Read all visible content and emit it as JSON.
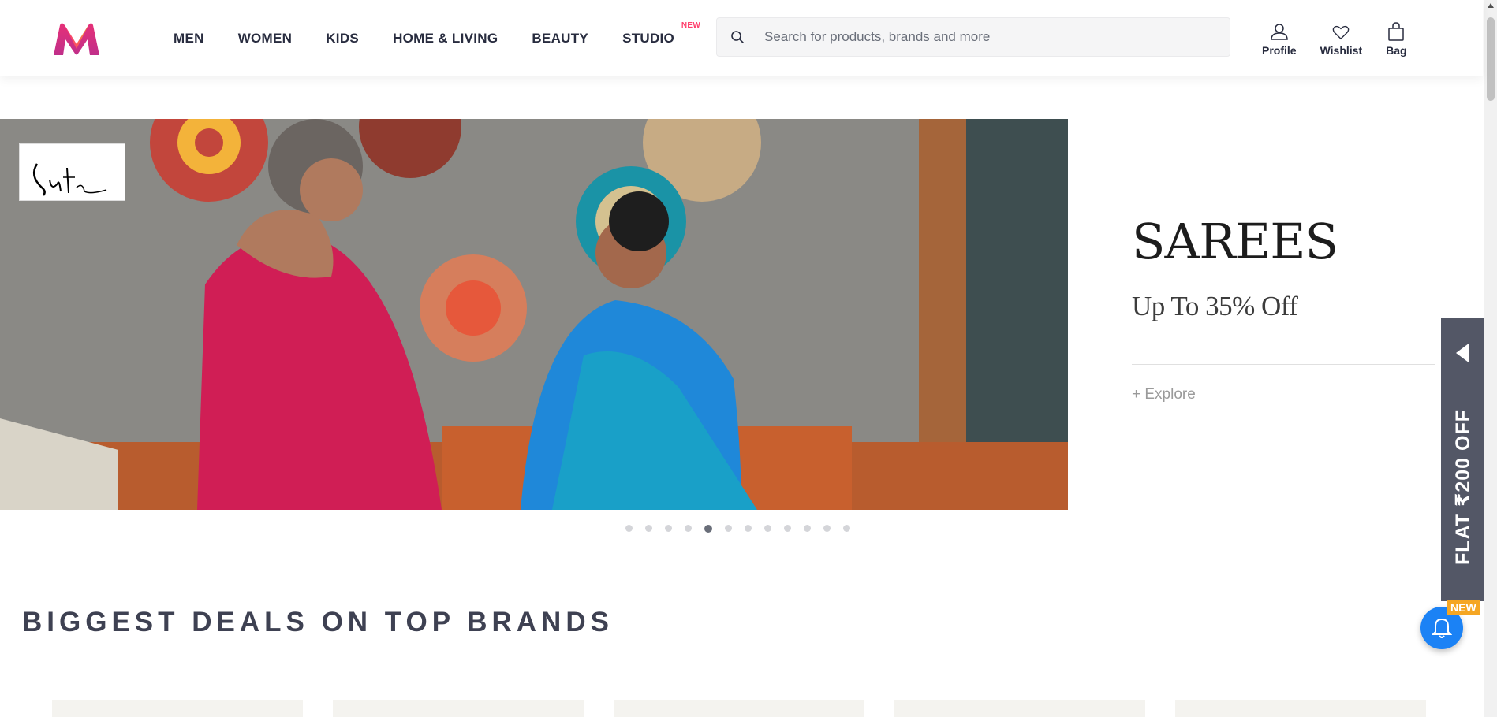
{
  "header": {
    "logo_icon": "myntra-logo-icon",
    "nav": [
      {
        "label": "MEN"
      },
      {
        "label": "WOMEN"
      },
      {
        "label": "KIDS"
      },
      {
        "label": "HOME & LIVING"
      },
      {
        "label": "BEAUTY"
      },
      {
        "label": "STUDIO",
        "badge": "NEW"
      }
    ],
    "search": {
      "placeholder": "Search for products, brands and more",
      "icon": "search-icon"
    },
    "actions": [
      {
        "label": "Profile",
        "icon": "profile-icon"
      },
      {
        "label": "Wishlist",
        "icon": "heart-icon"
      },
      {
        "label": "Bag",
        "icon": "bag-icon"
      }
    ]
  },
  "banner": {
    "brand_logo_text": "Suta",
    "title": "SAREES",
    "subtitle": "Up To 35% Off",
    "cta": "+ Explore",
    "slides_total": 12,
    "active_slide": 5
  },
  "section": {
    "title": "BIGGEST DEALS ON TOP BRANDS"
  },
  "side_offer": {
    "label": "FLAT ₹200 OFF",
    "badge": "NEW",
    "arrow_icon": "caret-left-icon"
  },
  "notification": {
    "icon": "bell-icon"
  },
  "colors": {
    "accent": "#ff3f6c",
    "offer_bg": "#535766",
    "bell_bg": "#1b82f5",
    "new_badge": "#f5a623"
  }
}
